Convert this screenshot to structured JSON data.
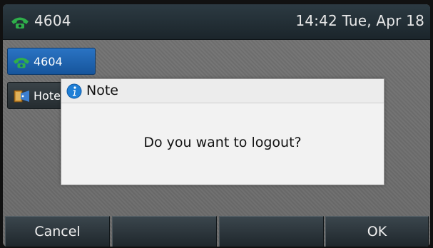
{
  "status_bar": {
    "line_icon": "phone-handset-icon",
    "line_label": "4604",
    "clock": "14:42 Tue, Apr 18"
  },
  "line_keys": [
    {
      "label": "4604",
      "icon": "phone-handset-icon",
      "state": "selected"
    },
    {
      "label": "Hotel",
      "icon": "hotelling-icon",
      "state": "idle"
    }
  ],
  "dialog": {
    "icon": "info-icon",
    "title": "Note",
    "message": "Do you want to logout?"
  },
  "soft_keys": [
    {
      "label": "Cancel"
    },
    {
      "label": ""
    },
    {
      "label": ""
    },
    {
      "label": "OK"
    }
  ],
  "colors": {
    "line_key_selected": "#2a73c3",
    "phone_icon_green": "#2fae4a",
    "info_icon_blue": "#1f7fd6"
  }
}
